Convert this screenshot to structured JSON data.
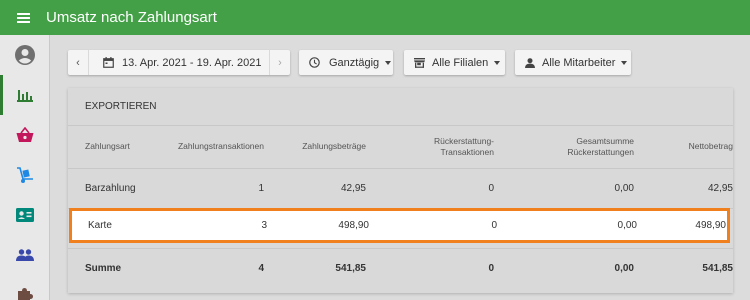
{
  "appbar": {
    "title": "Umsatz nach Zahlungsart"
  },
  "toolbar": {
    "date_range": "13. Apr. 2021 - 19. Apr. 2021",
    "time_filter": "Ganztägig",
    "branch_filter": "Alle Filialen",
    "staff_filter": "Alle Mitarbeiter"
  },
  "card": {
    "export_label": "EXPORTIEREN"
  },
  "table": {
    "headers": {
      "col1": "Zahlungsart",
      "col2": "Zahlungstransaktionen",
      "col3": "Zahlungsbeträge",
      "col4a": "Rückerstattung-",
      "col4b": "Transaktionen",
      "col5a": "Gesamtsumme",
      "col5b": "Rückerstattungen",
      "col6": "Nettobetrag"
    },
    "rows": [
      {
        "type": "Barzahlung",
        "transactions": "1",
        "amount": "42,95",
        "refund_tx": "0",
        "refund_total": "0,00",
        "net": "42,95"
      },
      {
        "type": "Karte",
        "transactions": "3",
        "amount": "498,90",
        "refund_tx": "0",
        "refund_total": "0,00",
        "net": "498,90"
      }
    ],
    "sum": {
      "type": "Summe",
      "transactions": "4",
      "amount": "541,85",
      "refund_tx": "0",
      "refund_total": "0,00",
      "net": "541,85"
    }
  },
  "colors": {
    "appbar": "#43a047",
    "highlight": "#f07f1e",
    "active_nav": "#2e7d32"
  },
  "icons": {
    "menu": "menu-icon",
    "nav": [
      "account-circle-icon",
      "bar-chart-icon",
      "basket-icon",
      "hand-truck-icon",
      "contact-card-icon",
      "people-icon",
      "puzzle-icon"
    ]
  }
}
